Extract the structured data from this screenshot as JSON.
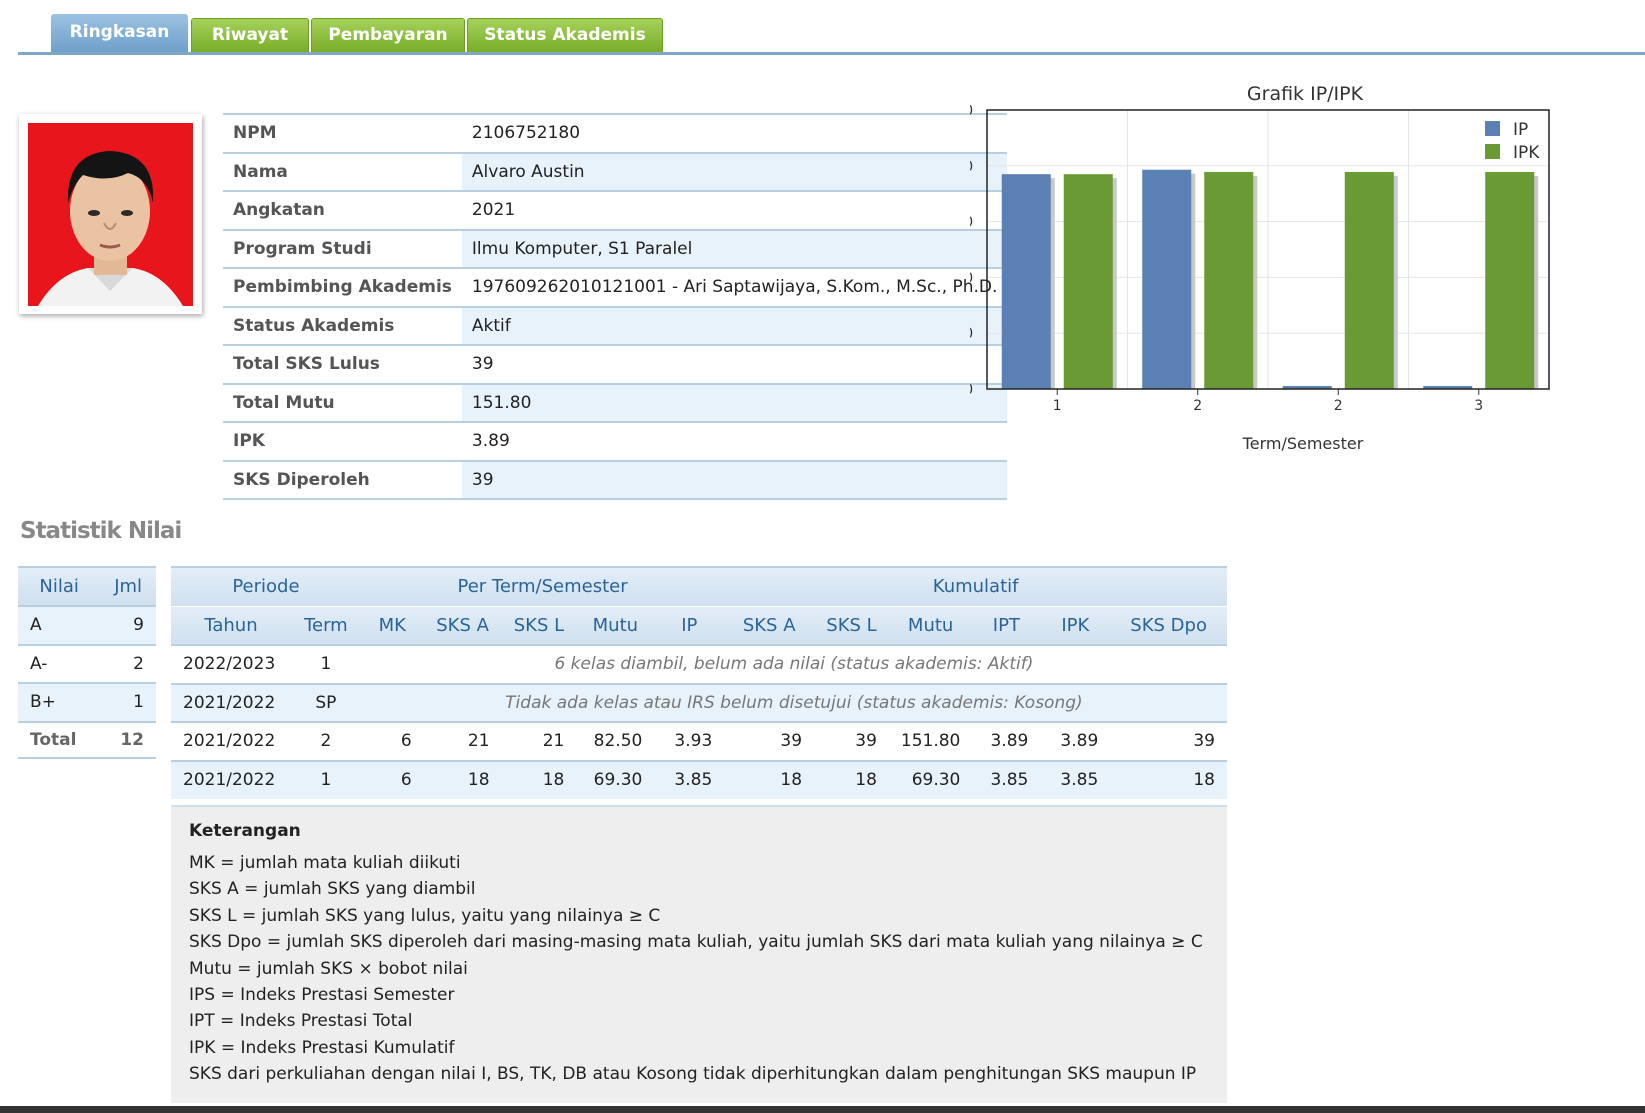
{
  "tabs": [
    {
      "label": "Ringkasan",
      "active": true
    },
    {
      "label": "Riwayat",
      "active": false
    },
    {
      "label": "Pembayaran",
      "active": false
    },
    {
      "label": "Status Akademis",
      "active": false
    }
  ],
  "profile": {
    "npm_label": "NPM",
    "npm": "2106752180",
    "nama_label": "Nama",
    "nama": "Alvaro Austin",
    "angkatan_label": "Angkatan",
    "angkatan": "2021",
    "prodi_label": "Program Studi",
    "prodi": "Ilmu Komputer, S1 Paralel",
    "pa_label": "Pembimbing Akademis",
    "pa": "197609262010121001 - Ari Saptawijaya, S.Kom., M.Sc., Ph.D.",
    "status_label": "Status Akademis",
    "status": "Aktif",
    "sks_lulus_label": "Total SKS Lulus",
    "sks_lulus": "39",
    "mutu_label": "Total Mutu",
    "mutu": "151.80",
    "ipk_label": "IPK",
    "ipk": "3.89",
    "sks_diperoleh_label": "SKS Diperoleh",
    "sks_diperoleh": "39"
  },
  "chart_data": {
    "type": "bar",
    "title": "Grafik IP/IPK",
    "xlabel": "Term/Semester",
    "ylabel": "",
    "categories": [
      "1",
      "2",
      "2",
      "3"
    ],
    "ylim": [
      0,
      5
    ],
    "yticks": [
      "0.0",
      "1.0",
      "2.0",
      "3.0",
      "4.0",
      "5.0"
    ],
    "series": [
      {
        "name": "IP",
        "color": "#5b80b4",
        "values": [
          3.85,
          3.93,
          0,
          0
        ]
      },
      {
        "name": "IPK",
        "color": "#6a9a34",
        "values": [
          3.85,
          3.89,
          3.89,
          3.89
        ]
      }
    ],
    "legend": "top-right",
    "grid": true
  },
  "section_title": "Statistik Nilai",
  "nilai": {
    "headers": [
      "Nilai",
      "Jml"
    ],
    "rows": [
      {
        "nilai": "A",
        "jml": "9"
      },
      {
        "nilai": "A-",
        "jml": "2"
      },
      {
        "nilai": "B+",
        "jml": "1"
      }
    ],
    "total_label": "Total",
    "total": "12"
  },
  "stats": {
    "group_headers": {
      "periode": "Periode",
      "term": "Per Term/Semester",
      "kum": "Kumulatif"
    },
    "headers": [
      "Tahun",
      "Term",
      "MK",
      "SKS A",
      "SKS L",
      "Mutu",
      "IP",
      "SKS A",
      "SKS L",
      "Mutu",
      "IPT",
      "IPK",
      "SKS Dpo"
    ],
    "note_rows": [
      {
        "tahun": "2022/2023",
        "term": "1",
        "note": "6 kelas diambil, belum ada nilai (status akademis: Aktif)"
      },
      {
        "tahun": "2021/2022",
        "term": "SP",
        "note": "Tidak ada kelas atau IRS belum disetujui (status akademis: Kosong)"
      }
    ],
    "rows": [
      [
        "2021/2022",
        "2",
        "6",
        "21",
        "21",
        "82.50",
        "3.93",
        "39",
        "39",
        "151.80",
        "3.89",
        "3.89",
        "39"
      ],
      [
        "2021/2022",
        "1",
        "6",
        "18",
        "18",
        "69.30",
        "3.85",
        "18",
        "18",
        "69.30",
        "3.85",
        "3.85",
        "18"
      ]
    ]
  },
  "keterangan": {
    "title": "Keterangan",
    "items": [
      "MK = jumlah mata kuliah diikuti",
      "SKS A = jumlah SKS yang diambil",
      "SKS L = jumlah SKS yang lulus, yaitu yang nilainya ≥ C",
      "SKS Dpo = jumlah SKS diperoleh dari masing-masing mata kuliah, yaitu jumlah SKS dari mata kuliah yang nilainya ≥ C",
      "Mutu = jumlah SKS × bobot nilai",
      "IPS = Indeks Prestasi Semester",
      "IPT = Indeks Prestasi Total",
      "IPK = Indeks Prestasi Kumulatif",
      "SKS dari perkuliahan dengan nilai I, BS, TK, DB atau Kosong tidak diperhitungkan dalam penghitungan SKS maupun IP"
    ]
  }
}
